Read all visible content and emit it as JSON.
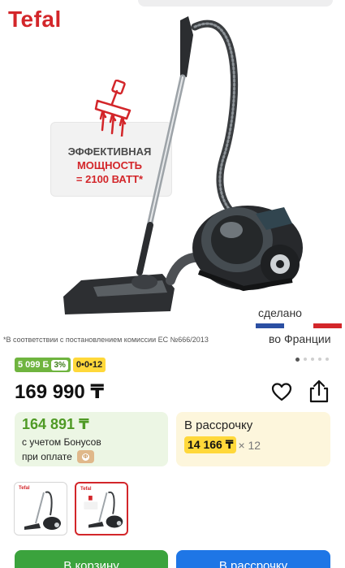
{
  "brand": {
    "logo_text": "Tefal",
    "color": "#d3262a"
  },
  "promo": {
    "line1": "ЭФФЕКТИВНАЯ",
    "line2": "МОЩНОСТЬ",
    "line3": "= 2100 ВАТТ*"
  },
  "origin": {
    "made_label": "сделано",
    "country": "во Франции",
    "flag_colors": [
      "#2b4fa3",
      "#ffffff",
      "#d3262a"
    ]
  },
  "footnote": "*В соответствии с постановлением комиссии ЕС №666/2013",
  "carousel": {
    "total": 5,
    "active_index": 0
  },
  "badges": {
    "bonus_amount": "5 099",
    "bonus_currency": "Б",
    "bonus_percent": "3%",
    "installment": "0•0•12"
  },
  "price": {
    "value": "169 990 ₸"
  },
  "icons": {
    "favorite": "heart-icon",
    "share": "share-icon"
  },
  "bonus_card": {
    "price": "164 891 ₸",
    "line1": "с учетом Бонусов",
    "line2": "при оплате",
    "coin_symbol": "Ф"
  },
  "credit_card": {
    "title": "В рассрочку",
    "amount": "14 166 ₸",
    "months": "× 12"
  },
  "thumbnails": [
    {
      "logo": "Tefal",
      "selected": false
    },
    {
      "logo": "Tefal",
      "selected": true
    }
  ],
  "actions": {
    "cart_label": "В корзину",
    "credit_label": "В рассрочку"
  },
  "colors": {
    "accent_green": "#3ba33d",
    "accent_blue": "#1e76e6",
    "installment_yellow": "#ffd83a",
    "bonus_green": "#4f9a25"
  }
}
